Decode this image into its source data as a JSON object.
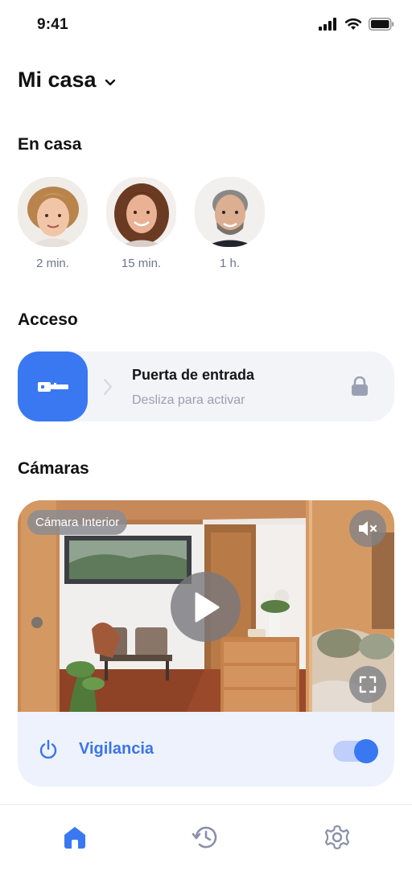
{
  "status_bar": {
    "time": "9:41"
  },
  "header": {
    "title": "Mi casa"
  },
  "sections": {
    "home": "En casa",
    "access": "Acceso",
    "cameras": "Cámaras"
  },
  "people": [
    {
      "time": "2 min."
    },
    {
      "time": "15 min."
    },
    {
      "time": "1 h."
    }
  ],
  "access": {
    "title": "Puerta de entrada",
    "subtitle": "Desliza para activar"
  },
  "camera": {
    "label": "Cámara Interior"
  },
  "surveillance": {
    "label": "Vigilancia",
    "enabled": true
  },
  "colors": {
    "accent": "#3a78f2",
    "muted": "#9aa0b4",
    "card": "#f3f4f8"
  },
  "tabs": [
    {
      "icon": "home-icon",
      "active": true
    },
    {
      "icon": "history-icon",
      "active": false
    },
    {
      "icon": "settings-icon",
      "active": false
    }
  ]
}
